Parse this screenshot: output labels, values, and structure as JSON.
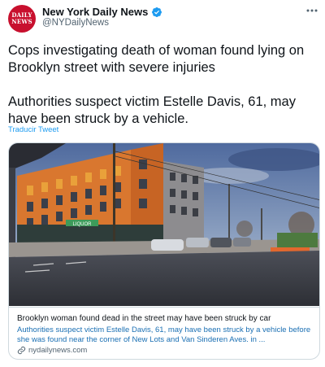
{
  "account": {
    "display_name": "New York Daily News",
    "handle": "@NYDailyNews",
    "avatar_text": "DAILY NEWS",
    "verified": true
  },
  "tweet": {
    "headline": "Cops investigating death of woman found lying on Brooklyn street with severe injuries",
    "summary": "Authorities suspect victim Estelle Davis, 61, may have been struck by a vehicle.",
    "translate_label": "Traducir Tweet"
  },
  "card": {
    "title": "Brooklyn woman found dead in the street may have been struck by car",
    "description": "Authorities suspect victim Estelle Davis, 61, may have been struck by a vehicle before she was found near the corner of New Lots and Van Sinderen Aves. in ...",
    "domain": "nydailynews.com",
    "image_sign": "LIQUOR"
  },
  "icons": {
    "verified": "verified-badge-icon",
    "more": "more-options-icon",
    "link": "link-icon"
  },
  "colors": {
    "brand_red": "#c8102e",
    "link_blue": "#1d9bf0",
    "verified_blue": "#1d9bf0"
  }
}
